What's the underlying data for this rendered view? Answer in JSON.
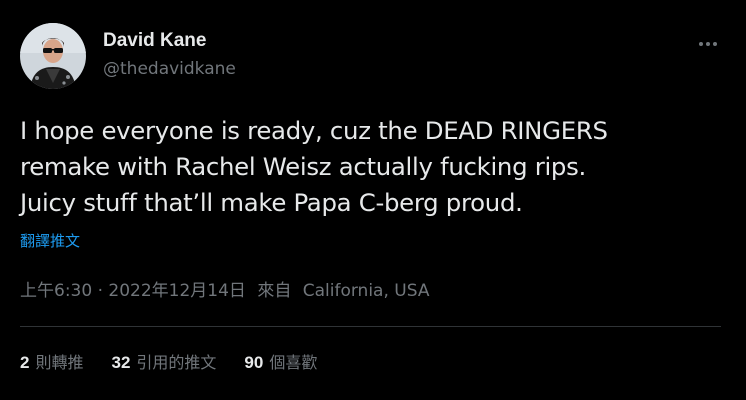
{
  "author": {
    "display_name": "David Kane",
    "handle": "@thedavidkane",
    "avatar_icon": "avatar-photo"
  },
  "more_icon": "more-horizontal-icon",
  "tweet": {
    "lines": [
      "I hope everyone is ready, cuz the DEAD RINGERS",
      "remake with Rachel Weisz actually fucking rips.",
      "Juicy stuff that’ll make Papa C-berg proud."
    ]
  },
  "translate_label": "翻譯推文",
  "meta": {
    "time": "上午6:30 · 2022年12月14日",
    "source_prefix": "來自",
    "source": "California, USA"
  },
  "stats": {
    "retweets": {
      "count": "2",
      "label": "則轉推"
    },
    "quotes": {
      "count": "32",
      "label": "引用的推文"
    },
    "likes": {
      "count": "90",
      "label": "個喜歡"
    }
  },
  "colors": {
    "background": "#000000",
    "text": "#e7e9ea",
    "secondary": "#71767b",
    "link": "#1d9bf0",
    "divider": "#2f3336"
  }
}
